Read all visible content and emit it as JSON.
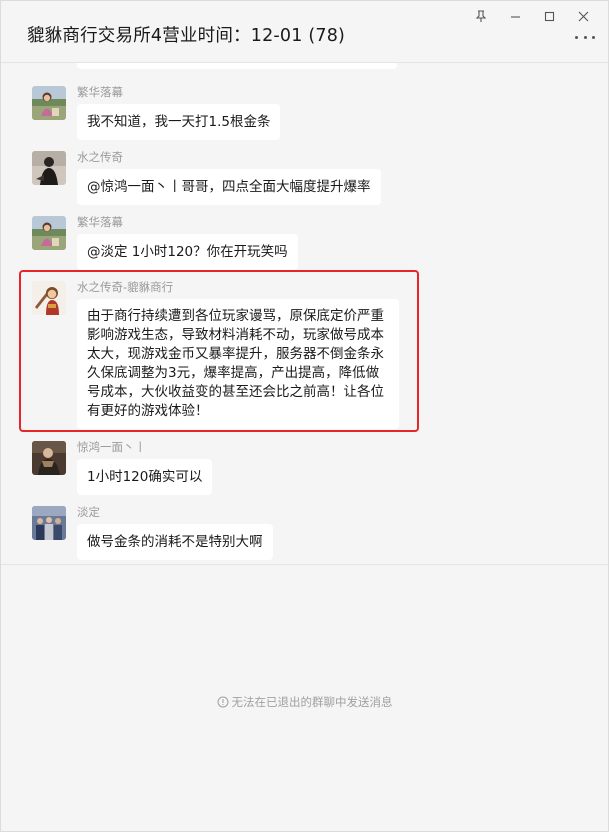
{
  "header": {
    "title": "貔貅商行交易所4营业时间：12-01 (78)"
  },
  "window_controls": [
    "pin-icon",
    "minimize-icon",
    "maximize-icon",
    "close-icon"
  ],
  "messages": [
    {
      "sender": "繁华落幕",
      "text": "我不知道，我一天打1.5根金条",
      "avatar": "avatar-woman-outdoor"
    },
    {
      "sender": "水之传奇",
      "text": "@惊鸿一面丶丨哥哥，四点全面大幅度提升爆率",
      "avatar": "avatar-dark-figure"
    },
    {
      "sender": "繁华落幕",
      "text": "@淡定 1小时120？你在开玩笑吗",
      "avatar": "avatar-woman-outdoor"
    },
    {
      "sender": "水之传奇-貔貅商行",
      "text": "由于商行持续遭到各位玩家谩骂，原保底定价严重影响游戏生态，导致材料消耗不动，玩家做号成本太大，现游戏金币又暴率提升，服务器不倒金条永久保底调整为3元，爆率提高，产出提高，降低做号成本，大伙收益变的甚至还会比之前高！让各位有更好的游戏体验！",
      "avatar": "avatar-cartoon-warrior"
    },
    {
      "sender": "惊鸿一面丶丨",
      "text": "1小时120确实可以",
      "avatar": "avatar-game-character"
    },
    {
      "sender": "淡定",
      "text": "做号金条的消耗不是特别大啊",
      "avatar": "avatar-crowd-photo"
    }
  ],
  "footer": {
    "notice": "无法在已退出的群聊中发送消息"
  },
  "colors": {
    "background": "#f5f5f5",
    "bubble": "#ffffff",
    "highlight": "#e8262a",
    "sender_text": "#9a9a9a"
  }
}
